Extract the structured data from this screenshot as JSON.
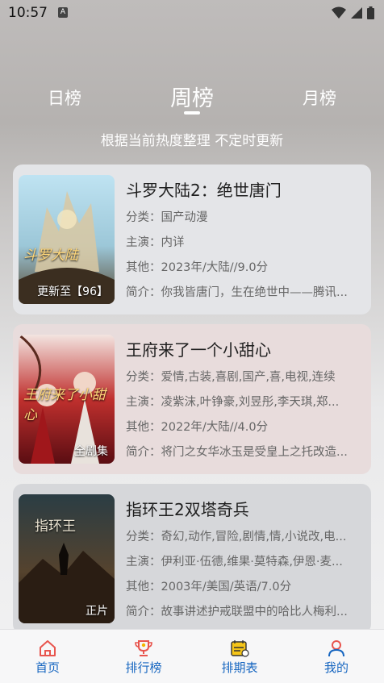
{
  "status_bar": {
    "time": "10:57",
    "notif_badge": "A"
  },
  "tabs": [
    {
      "label": "日榜",
      "active": false
    },
    {
      "label": "周榜",
      "active": true
    },
    {
      "label": "月榜",
      "active": false
    }
  ],
  "subtitle": "根据当前热度整理 不定时更新",
  "items": [
    {
      "title": "斗罗大陆2：绝世唐门",
      "category": "分类：国产动漫",
      "cast": "主演：内详",
      "other": "其他：2023年/大陆//9.0分",
      "intro": "简介：你我皆唐门，生在绝世中——腾讯...",
      "tag": "更新至【96】",
      "poster_text": "斗罗大陆"
    },
    {
      "title": "王府来了一个小甜心",
      "category": "分类：爱情,古装,喜剧,国产,喜,电视,连续",
      "cast": "主演：凌紫沫,叶铮豪,刘昱彤,李天琪,郑...",
      "other": "其他：2022年/大陆//4.0分",
      "intro": "简介：将门之女华冰玉是受皇上之托改造...",
      "tag": "全剧集",
      "poster_text": "王府来了小甜心"
    },
    {
      "title": "指环王2双塔奇兵",
      "category": "分类：奇幻,动作,冒险,剧情,情,小说改,电...",
      "cast": "主演：伊利亚·伍德,维果·莫特森,伊恩·麦...",
      "other": "其他：2003年/美国/英语/7.0分",
      "intro": "简介：故事讲述护戒联盟中的哈比人梅利...",
      "tag": "正片",
      "poster_text": "指环王"
    }
  ],
  "bottom_nav": [
    {
      "label": "首页",
      "icon": "home-icon",
      "color": "#e8554e"
    },
    {
      "label": "排行榜",
      "icon": "trophy-icon",
      "color": "#1565c0"
    },
    {
      "label": "排期表",
      "icon": "calendar-icon",
      "color": "#1565c0"
    },
    {
      "label": "我的",
      "icon": "user-icon",
      "color": "#1565c0"
    }
  ]
}
